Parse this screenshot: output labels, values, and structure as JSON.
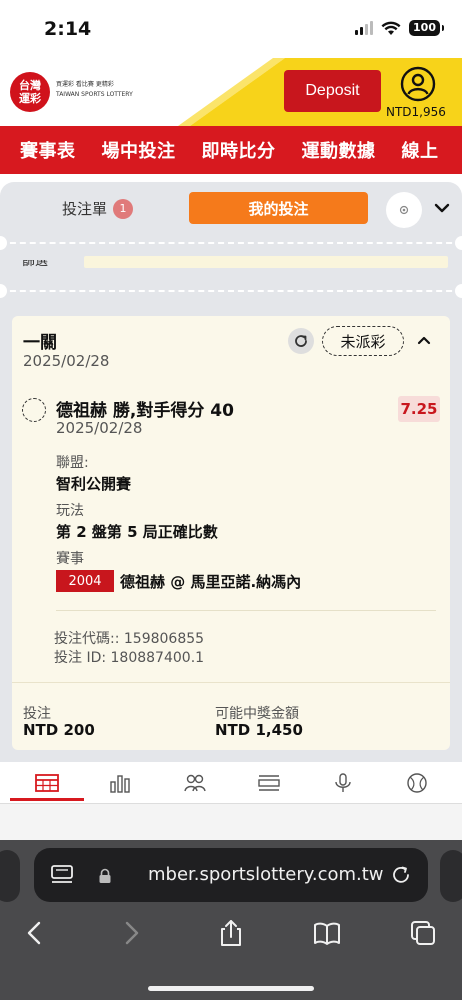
{
  "status_bar": {
    "time": "2:14",
    "battery": "100"
  },
  "header": {
    "logo_text": "台灣\n運彩",
    "logo_subtext": "買運彩 看比賽 更精彩\nTAIWAN SPORTS LOTTERY",
    "deposit_label": "Deposit",
    "balance": "NTD1,956"
  },
  "nav": {
    "items": [
      "賽事表",
      "場中投注",
      "即時比分",
      "運動數據",
      "線上"
    ]
  },
  "slip": {
    "tab_betslip": "投注單",
    "tab_betslip_count": "1",
    "tab_mybets": "我的投注",
    "filter_label": "篩選"
  },
  "bet": {
    "type": "一關",
    "date": "2025/02/28",
    "status": "未派彩",
    "selection_title": "德祖赫 勝,對手得分 40",
    "selection_date": "2025/02/28",
    "odds": "7.25",
    "league_label": "聯盟:",
    "league_value": "智利公開賽",
    "market_label": "玩法",
    "market_value": "第 2 盤第 5 局正確比數",
    "event_label": "賽事",
    "event_code": "2004",
    "event_name": "德祖赫 @ 馬里亞諾.納馮內",
    "bet_code_line": "投注代碼:: 159806855",
    "bet_id_line": "投注 ID: 180887400.1",
    "stake_label": "投注",
    "stake_value": "NTD 200",
    "potential_label": "可能中獎金額",
    "potential_value": "NTD 1,450"
  },
  "browser": {
    "url": "mber.sportslottery.com.tw"
  },
  "colors": {
    "brand_red": "#d7191f",
    "accent_orange": "#f57a1b",
    "header_yellow": "#f7d31a",
    "card_bg": "#fbf8ea"
  }
}
